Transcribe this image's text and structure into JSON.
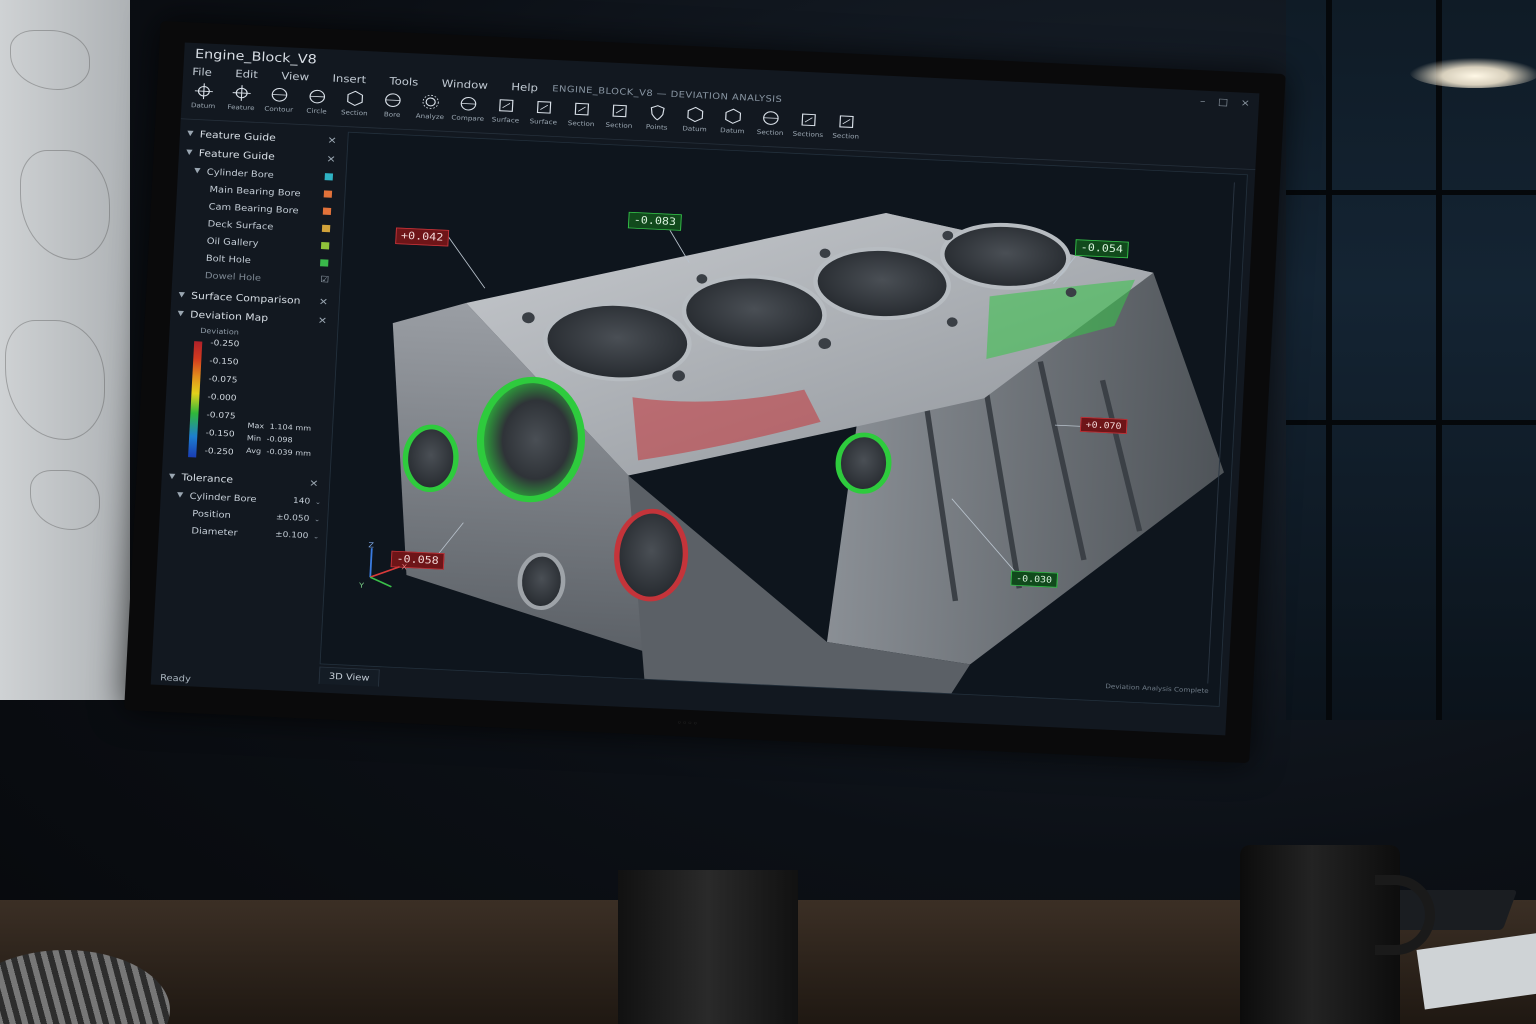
{
  "app": {
    "title": "Engine_Block_V8",
    "path_text": "ENGINE_BLOCK_V8 — DEVIATION ANALYSIS",
    "window_controls": [
      "–",
      "□",
      "×"
    ]
  },
  "menu": [
    "File",
    "Edit",
    "View",
    "Insert",
    "Tools",
    "Window",
    "Help"
  ],
  "toolbar": [
    {
      "icon": "crosshair-icon",
      "label": "Datum"
    },
    {
      "icon": "crosshair-icon",
      "label": "Feature"
    },
    {
      "icon": "circle-icon",
      "label": "Contour"
    },
    {
      "icon": "circle-icon",
      "label": "Circle"
    },
    {
      "icon": "hexagon-icon",
      "label": "Section"
    },
    {
      "icon": "circle-icon",
      "label": "Bore"
    },
    {
      "icon": "gear-icon",
      "label": "Analyze"
    },
    {
      "icon": "circle-icon",
      "label": "Compare"
    },
    {
      "icon": "square-icon",
      "label": "Surface"
    },
    {
      "icon": "square-icon",
      "label": "Surface"
    },
    {
      "icon": "square-icon",
      "label": "Section"
    },
    {
      "icon": "square-icon",
      "label": "Section"
    },
    {
      "icon": "shield-icon",
      "label": "Points"
    },
    {
      "icon": "hexagon-icon",
      "label": "Datum"
    },
    {
      "icon": "hexagon-icon",
      "label": "Datum"
    },
    {
      "icon": "circle-icon",
      "label": "Section"
    },
    {
      "icon": "square-icon",
      "label": "Sections"
    },
    {
      "icon": "square-icon",
      "label": "Section"
    }
  ],
  "sidebar": {
    "feature_guide_outer": "Feature Guide",
    "feature_guide_inner": "Feature Guide",
    "features": [
      {
        "label": "Cylinder Bore",
        "color": "#2fb3c4"
      },
      {
        "label": "Main Bearing Bore",
        "color": "#e2723a"
      },
      {
        "label": "Cam Bearing Bore",
        "color": "#e2723a"
      },
      {
        "label": "Deck Surface",
        "color": "#d1a23a"
      },
      {
        "label": "Oil Gallery",
        "color": "#8fc23a"
      },
      {
        "label": "Bolt Hole",
        "color": "#3ab84a"
      },
      {
        "label": "Dowel Hole",
        "color": ""
      }
    ],
    "surface_comparison": "Surface Comparison",
    "deviation_map": "Deviation Map",
    "legend_header": "Deviation",
    "legend_ticks": [
      "-0.250",
      "-0.150",
      "-0.075",
      "-0.000",
      "-0.075",
      "-0.150",
      "-0.250"
    ],
    "stats": {
      "max_label": "Max",
      "max_value": "1.104 mm",
      "min_label": "Min",
      "min_value": "-0.098",
      "avg_label": "Avg",
      "avg_value": "-0.039 mm"
    },
    "tolerance": "Tolerance",
    "tolerance_group": {
      "label": "Cylinder Bore",
      "value": "140"
    },
    "tolerance_rows": [
      {
        "label": "Position",
        "value": "±0.050"
      },
      {
        "label": "Diameter",
        "value": "±0.100"
      }
    ]
  },
  "viewport": {
    "tab": "3D View",
    "callouts": [
      {
        "text": "-0.083",
        "kind": "green"
      },
      {
        "text": "+0.042",
        "kind": "red"
      },
      {
        "text": "-0.054",
        "kind": "green"
      },
      {
        "text": "+0.070",
        "kind": "red"
      },
      {
        "text": "-0.030",
        "kind": "green"
      },
      {
        "text": "-0.058",
        "kind": "red"
      }
    ],
    "axis_labels": [
      "Z",
      "X",
      "Y"
    ],
    "footer_text": "Deviation Analysis Complete"
  },
  "status": "Ready",
  "colors": {
    "deviation_red": "#c4343a",
    "deviation_green": "#35c24a"
  }
}
